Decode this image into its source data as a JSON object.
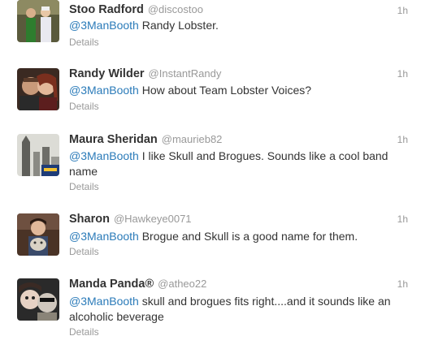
{
  "tweets": [
    {
      "name": "Stoo Radford",
      "handle": "@discostoo",
      "time": "1h",
      "mention": "@3ManBooth",
      "text": "Randy Lobster.",
      "details": "Details",
      "avatar": "avatar-costume-photo"
    },
    {
      "name": "Randy Wilder",
      "handle": "@InstantRandy",
      "time": "1h",
      "mention": "@3ManBooth",
      "text": "How about Team Lobster Voices?",
      "details": "Details",
      "avatar": "avatar-couple-photo"
    },
    {
      "name": "Maura Sheridan",
      "handle": "@maurieb82",
      "time": "1h",
      "mention": "@3ManBooth",
      "text": "I like Skull and Brogues. Sounds like a cool band name",
      "details": "Details",
      "avatar": "avatar-city-photo"
    },
    {
      "name": "Sharon",
      "handle": "@Hawkeye0071",
      "time": "1h",
      "mention": "@3ManBooth",
      "text": "Brogue and Skull is a good name for them.",
      "details": "Details",
      "avatar": "avatar-person-cat-photo"
    },
    {
      "name": "Manda Panda®",
      "handle": "@atheo22",
      "time": "1h",
      "mention": "@3ManBooth",
      "text": "skull and brogues fits right....and it sounds like an alcoholic beverage",
      "details": "Details",
      "avatar": "avatar-two-faces-photo"
    }
  ],
  "colors": {
    "link": "#2b7bb9",
    "muted": "#999999",
    "text": "#333333",
    "divider": "#e8e8e8"
  }
}
